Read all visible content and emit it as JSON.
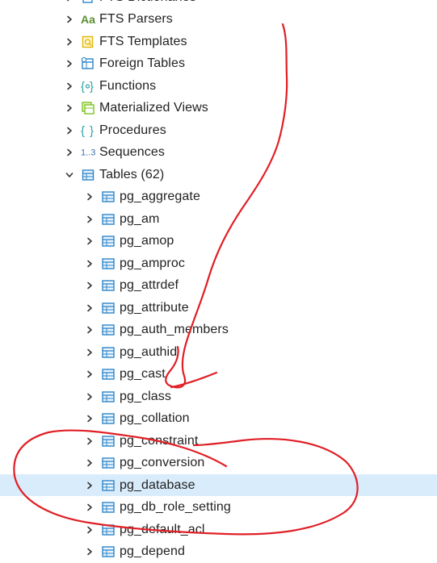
{
  "tree": {
    "items": [
      {
        "label": "FTS Dictionaries",
        "icon": "dictionary-icon",
        "level": 0,
        "expanded": false
      },
      {
        "label": "FTS Parsers",
        "icon": "parser-icon",
        "level": 0,
        "expanded": false
      },
      {
        "label": "FTS Templates",
        "icon": "template-icon",
        "level": 0,
        "expanded": false
      },
      {
        "label": "Foreign Tables",
        "icon": "foreign-table-icon",
        "level": 0,
        "expanded": false
      },
      {
        "label": "Functions",
        "icon": "function-icon",
        "level": 0,
        "expanded": false
      },
      {
        "label": "Materialized Views",
        "icon": "materialized-view-icon",
        "level": 0,
        "expanded": false
      },
      {
        "label": "Procedures",
        "icon": "procedure-icon",
        "level": 0,
        "expanded": false
      },
      {
        "label": "Sequences",
        "icon": "sequence-icon",
        "level": 0,
        "expanded": false
      },
      {
        "label": "Tables (62)",
        "icon": "tables-icon",
        "level": 0,
        "expanded": true
      },
      {
        "label": "pg_aggregate",
        "icon": "table-icon",
        "level": 1,
        "expanded": false
      },
      {
        "label": "pg_am",
        "icon": "table-icon",
        "level": 1,
        "expanded": false
      },
      {
        "label": "pg_amop",
        "icon": "table-icon",
        "level": 1,
        "expanded": false
      },
      {
        "label": "pg_amproc",
        "icon": "table-icon",
        "level": 1,
        "expanded": false
      },
      {
        "label": "pg_attrdef",
        "icon": "table-icon",
        "level": 1,
        "expanded": false
      },
      {
        "label": "pg_attribute",
        "icon": "table-icon",
        "level": 1,
        "expanded": false
      },
      {
        "label": "pg_auth_members",
        "icon": "table-icon",
        "level": 1,
        "expanded": false
      },
      {
        "label": "pg_authid",
        "icon": "table-icon",
        "level": 1,
        "expanded": false
      },
      {
        "label": "pg_cast",
        "icon": "table-icon",
        "level": 1,
        "expanded": false
      },
      {
        "label": "pg_class",
        "icon": "table-icon",
        "level": 1,
        "expanded": false
      },
      {
        "label": "pg_collation",
        "icon": "table-icon",
        "level": 1,
        "expanded": false
      },
      {
        "label": "pg_constraint",
        "icon": "table-icon",
        "level": 1,
        "expanded": false
      },
      {
        "label": "pg_conversion",
        "icon": "table-icon",
        "level": 1,
        "expanded": false
      },
      {
        "label": "pg_database",
        "icon": "table-icon",
        "level": 1,
        "expanded": false,
        "selected": true
      },
      {
        "label": "pg_db_role_setting",
        "icon": "table-icon",
        "level": 1,
        "expanded": false
      },
      {
        "label": "pg_default_acl",
        "icon": "table-icon",
        "level": 1,
        "expanded": false
      },
      {
        "label": "pg_depend",
        "icon": "table-icon",
        "level": 1,
        "expanded": false
      }
    ]
  },
  "colors": {
    "selection": "#d9ecfb",
    "chevron": "#333333",
    "table_icon": "#2e86c9",
    "parser_icon": "#5a8f2e",
    "template_icon": "#e0b400",
    "function_icon": "#2ea3a3",
    "matview_icon": "#7cc41e",
    "sequence_icon": "#3a6fb0",
    "annotation": "#e01f26"
  }
}
